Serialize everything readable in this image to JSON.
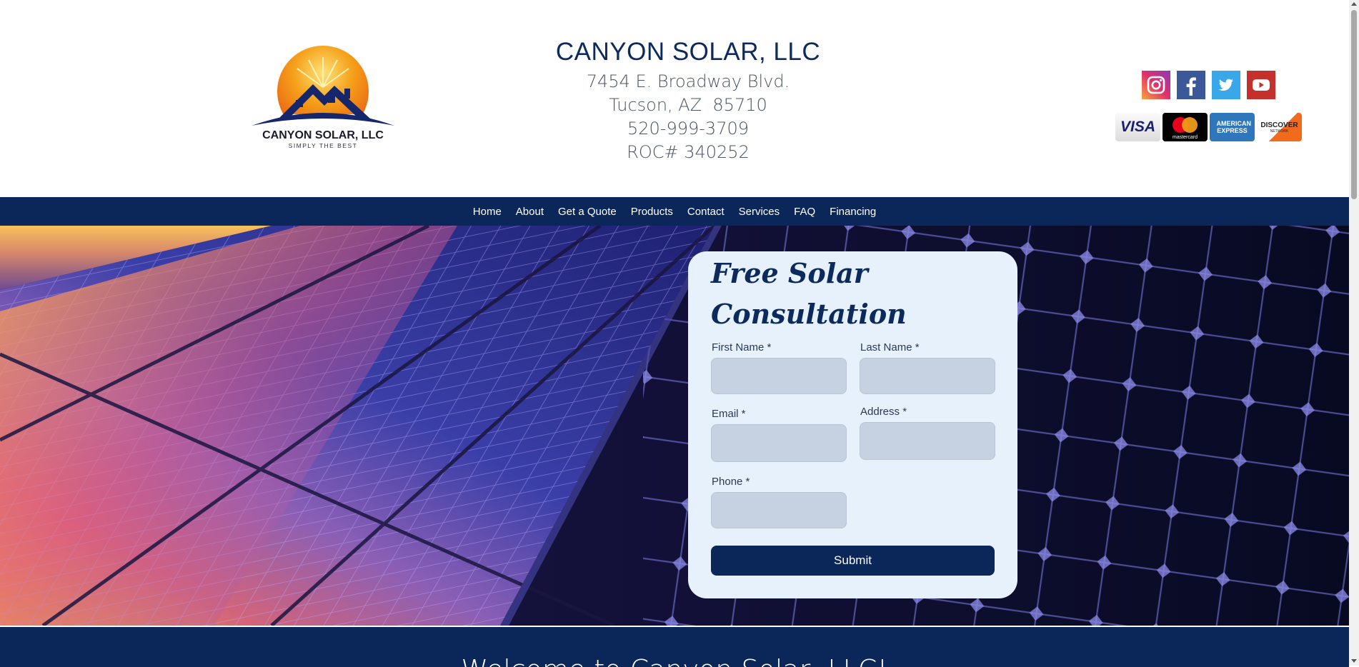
{
  "header": {
    "logo": {
      "title": "CANYON SOLAR, LLC",
      "tagline": "SIMPLY THE BEST"
    },
    "company_name": "CANYON SOLAR, LLC",
    "address_line1": "7454 E. Broadway Blvd.",
    "address_line2": "Tucson, AZ  85710",
    "phone": "520-999-3709",
    "license": "ROC# 340252",
    "socials": [
      {
        "name": "Instagram",
        "icon": "instagram-icon",
        "color": "#e1306c"
      },
      {
        "name": "Facebook",
        "icon": "facebook-icon",
        "color": "#3b5998"
      },
      {
        "name": "Twitter",
        "icon": "twitter-icon",
        "color": "#3aa7e8"
      },
      {
        "name": "YouTube",
        "icon": "youtube-icon",
        "color": "#c4302b"
      }
    ],
    "payment_cards": [
      {
        "label": "VISA",
        "icon": "visa-icon"
      },
      {
        "label": "mastercard",
        "icon": "mastercard-icon"
      },
      {
        "label": "AMERICAN EXPRESS",
        "icon": "amex-icon"
      },
      {
        "label": "DISCOVER",
        "sublabel": "NETWORK",
        "icon": "discover-icon"
      }
    ]
  },
  "nav": {
    "items": [
      "Home",
      "About",
      "Get a Quote",
      "Products",
      "Contact",
      "Services",
      "FAQ",
      "Financing"
    ]
  },
  "form": {
    "title": "Free Solar Consultation",
    "fields": {
      "first_name": {
        "label": "First Name *",
        "value": ""
      },
      "last_name": {
        "label": "Last Name *",
        "value": ""
      },
      "email": {
        "label": "Email *",
        "value": ""
      },
      "address": {
        "label": "Address *",
        "value": ""
      },
      "phone": {
        "label": "Phone *",
        "value": ""
      }
    },
    "submit_label": "Submit"
  },
  "welcome": {
    "title": "Welcome to Canyon Solar, LLC!"
  },
  "colors": {
    "navy": "#0b2658",
    "form_bg": "#e7f1fb",
    "input_bg": "#c6d1e2",
    "sun_orange": "#f39a1a"
  }
}
